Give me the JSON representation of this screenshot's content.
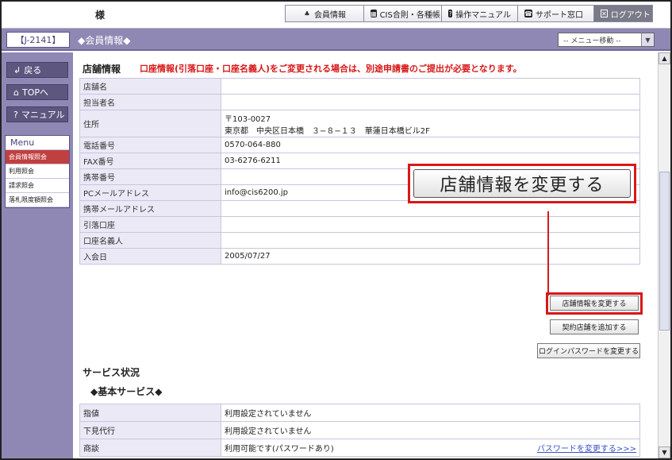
{
  "header": {
    "user_suffix": "様",
    "tabs": [
      {
        "icon": "♣",
        "label": "会員情報"
      },
      {
        "icon": "▦",
        "label": "CIS合則・各種帳り"
      },
      {
        "icon": "?",
        "label": "操作マニュアル"
      },
      {
        "icon": "☎",
        "label": "サポート窓口"
      },
      {
        "icon": "✕",
        "label": "ログアウト"
      }
    ]
  },
  "titlebar": {
    "member_code": "【J-2141】",
    "page_heading": "◆会員情報◆",
    "menu_select": "-- メニュー移動 --"
  },
  "sidebar": {
    "back": "戻る",
    "top": "TOPへ",
    "manual": "マニュアル",
    "menu_title": "Menu",
    "menu_items": [
      "会員情報照会",
      "利用照会",
      "請求照会",
      "落札限度額照会"
    ]
  },
  "store": {
    "title": "店舗情報",
    "warning": "口座情報(引落口座・口座名義人)をご変更される場合は、別途申請書のご提出が必要となります。",
    "rows": [
      {
        "label": "店舗名",
        "value": ""
      },
      {
        "label": "担当者名",
        "value": ""
      },
      {
        "label": "住所",
        "value": "〒103-0027",
        "value2": "東京都　中央区日本橋　３−８−１３　華蓮日本橋ビル2F"
      },
      {
        "label": "電話番号",
        "value": "0570-064-880"
      },
      {
        "label": "FAX番号",
        "value": "03-6276-6211"
      },
      {
        "label": "携帯番号",
        "value": ""
      },
      {
        "label": "PCメールアドレス",
        "value": "info@cis6200.jp"
      },
      {
        "label": "携帯メールアドレス",
        "value": ""
      },
      {
        "label": "引落口座",
        "value": ""
      },
      {
        "label": "口座名義人",
        "value": ""
      },
      {
        "label": "入会日",
        "value": "2005/07/27"
      }
    ],
    "buttons": {
      "change_store": "店舗情報を変更する",
      "add_contract": "契約店舗を追加する",
      "change_login_pw": "ログインパスワードを変更する"
    },
    "callout_label": "店舗情報を変更する"
  },
  "service": {
    "title": "サービス状況",
    "basic_title": "◆基本サービス◆",
    "rows": [
      {
        "label": "指値",
        "value": "利用設定されていません"
      },
      {
        "label": "下見代行",
        "value": "利用設定されていません"
      },
      {
        "label": "商談",
        "value": "利用可能です(パスワードあり)",
        "link": "パスワードを変更する>>>"
      }
    ]
  }
}
